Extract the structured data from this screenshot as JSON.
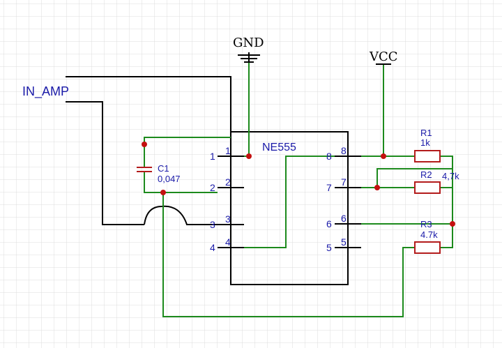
{
  "labels": {
    "gnd": "GND",
    "vcc": "VCC",
    "input": "IN_AMP",
    "ic": "NE555"
  },
  "components": {
    "c1": {
      "ref": "C1",
      "value": "0,047"
    },
    "r1": {
      "ref": "R1",
      "value": "1k"
    },
    "r2": {
      "ref": "R2",
      "value": "4,7k"
    },
    "r3": {
      "ref": "R3",
      "value": "4.7k"
    }
  },
  "pins": {
    "p1": {
      "inner": "1",
      "outer": "1"
    },
    "p2": {
      "inner": "2",
      "outer": "2"
    },
    "p3": {
      "inner": "3",
      "outer": "3"
    },
    "p4": {
      "inner": "4",
      "outer": "4"
    },
    "p5": {
      "inner": "5",
      "outer": "5"
    },
    "p6": {
      "inner": "6",
      "outer": "6"
    },
    "p7": {
      "inner": "7",
      "outer": "7"
    },
    "p8": {
      "inner": "8",
      "outer": "8"
    }
  },
  "colors": {
    "wire": "#1c8a1c",
    "symbol": "#000000",
    "label": "#1a1aa8",
    "resistor": "#b31b1b",
    "junction": "#c41010",
    "grid": "#dcdcdc"
  }
}
